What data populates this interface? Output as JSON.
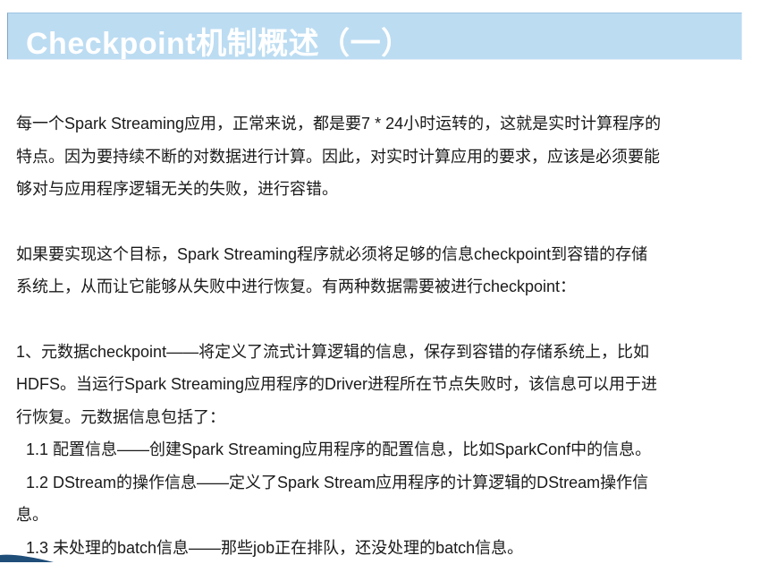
{
  "slide": {
    "title": "Checkpoint机制概述（一）"
  },
  "body": {
    "intro_lines": [
      "每一个Spark Streaming应用，正常来说，都是要7 * 24小时运转的，这就是实时计算程序的",
      "特点。因为要持续不断的对数据进行计算。因此，对实时计算应用的要求，应该是必须要能",
      "够对与应用程序逻辑无关的失败，进行容错。"
    ],
    "goal_lines": [
      "如果要实现这个目标，Spark Streaming程序就必须将足够的信息checkpoint到容错的存储",
      "系统上，从而让它能够从失败中进行恢复。有两种数据需要被进行checkpoint："
    ],
    "item1_lines": [
      "1、元数据checkpoint——将定义了流式计算逻辑的信息，保存到容错的存储系统上，比如",
      "HDFS。当运行Spark Streaming应用程序的Driver进程所在节点失败时，该信息可以用于进",
      "行恢复。元数据信息包括了："
    ],
    "sub_items": {
      "s1": [
        "1.1 配置信息——创建Spark Streaming应用程序的配置信息，比如SparkConf中的信息。"
      ],
      "s2": [
        "1.2 DStream的操作信息——定义了Spark Stream应用程序的计算逻辑的DStream操作信",
        "息。"
      ],
      "s3": [
        "1.3 未处理的batch信息——那些job正在排队，还没处理的batch信息。"
      ]
    }
  },
  "colors": {
    "title_bar": "#bcdcf2",
    "title_text": "#ffffff",
    "body_text": "#1a1a1a",
    "corner_accent": "#1f4e79"
  }
}
